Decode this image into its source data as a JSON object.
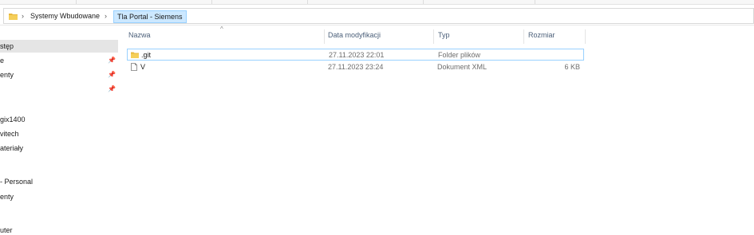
{
  "breadcrumb": {
    "items": [
      "Systemy Wbudowane",
      "Tla Portal - Siemens"
    ]
  },
  "nav": {
    "items": [
      {
        "label": "stęp",
        "pinned": false,
        "selected": true
      },
      {
        "label": "e",
        "pinned": true,
        "selected": false
      },
      {
        "label": "enty",
        "pinned": true,
        "selected": false
      },
      {
        "label": "",
        "pinned": true,
        "selected": false
      },
      {
        "label": "gix1400",
        "pinned": false,
        "selected": false
      },
      {
        "label": "vitech",
        "pinned": false,
        "selected": false
      },
      {
        "label": "ateriały",
        "pinned": false,
        "selected": false
      },
      {
        "label": "- Personal",
        "pinned": false,
        "selected": false
      },
      {
        "label": "enty",
        "pinned": false,
        "selected": false
      },
      {
        "label": "uter",
        "pinned": false,
        "selected": false
      }
    ]
  },
  "columns": {
    "name": "Nazwa",
    "modified": "Data modyfikacji",
    "type": "Typ",
    "size": "Rozmiar"
  },
  "files": [
    {
      "name": ".git",
      "modified": "27.11.2023 22:01",
      "type": "Folder plików",
      "size": "",
      "icon": "folder-icon"
    },
    {
      "name": "V",
      "modified": "27.11.2023 23:24",
      "type": "Dokument XML",
      "size": "6 KB",
      "icon": "file-icon"
    }
  ],
  "colors": {
    "folder": "#e8b83e",
    "selection": "#cce8ff",
    "selection_border": "#99d1ff",
    "header_text": "#4c607a"
  }
}
